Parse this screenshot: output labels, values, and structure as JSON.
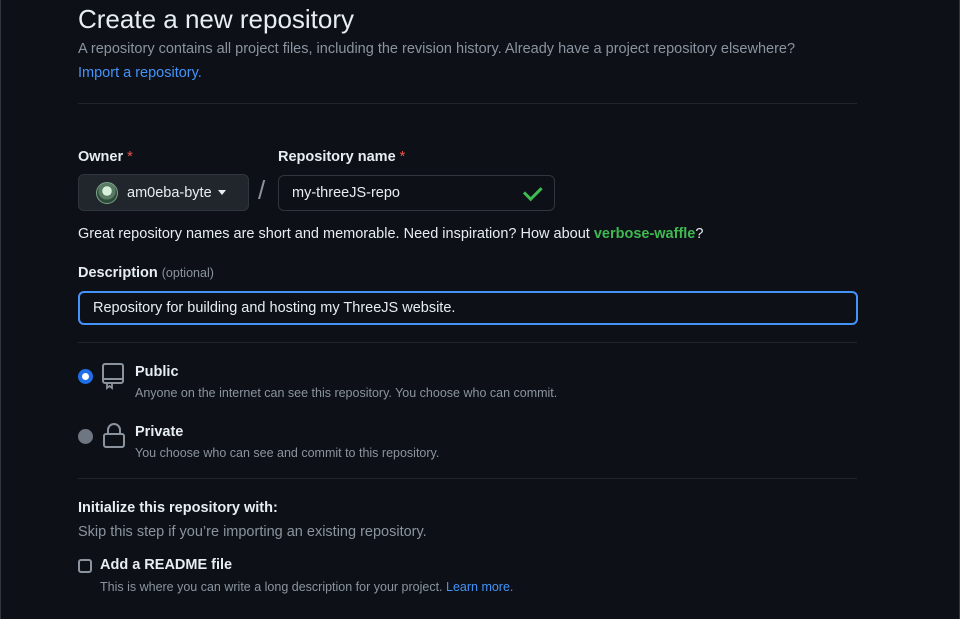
{
  "page": {
    "title": "Create a new repository",
    "subtitle": "A repository contains all project files, including the revision history. Already have a project repository elsewhere?",
    "import_link": "Import a repository."
  },
  "owner": {
    "label": "Owner",
    "required_mark": "*",
    "value": "am0eba-byte",
    "avatar": "avatar-image"
  },
  "repo": {
    "label": "Repository name",
    "required_mark": "*",
    "separator": "/",
    "value": "my-threeJS-repo",
    "status_icon": "check-icon",
    "hint_prefix": "Great repository names are short and memorable. Need inspiration? How about ",
    "suggestion": "verbose-waffle",
    "hint_suffix": "?"
  },
  "description": {
    "label": "Description",
    "optional": "(optional)",
    "value": "Repository for building and hosting my ThreeJS website."
  },
  "visibility": {
    "options": [
      {
        "title": "Public",
        "desc": "Anyone on the internet can see this repository. You choose who can commit.",
        "icon": "repo-icon",
        "selected": true
      },
      {
        "title": "Private",
        "desc": "You choose who can see and commit to this repository.",
        "icon": "lock-icon",
        "selected": false
      }
    ]
  },
  "init": {
    "title": "Initialize this repository with:",
    "subtitle": "Skip this step if you’re importing an existing repository.",
    "readme_label": "Add a README file",
    "readme_desc": "This is where you can write a long description for your project. ",
    "learn_more": "Learn more.",
    "readme_checked": false
  },
  "colors": {
    "background": "#0d1117",
    "accent": "#4493f8",
    "success": "#3fb950",
    "required": "#f85149"
  }
}
